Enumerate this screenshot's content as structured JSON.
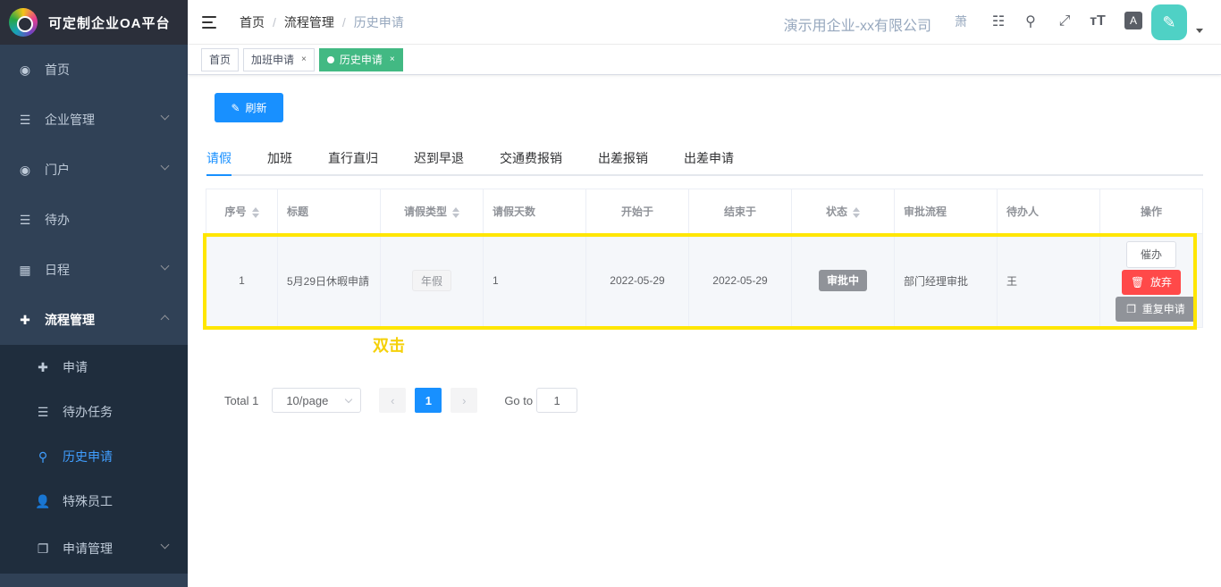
{
  "app": {
    "title": "可定制企业OA平台"
  },
  "sidebar": {
    "items": [
      {
        "label": "首页",
        "icon": "dashboard-icon"
      },
      {
        "label": "企业管理",
        "icon": "list-icon"
      },
      {
        "label": "门户",
        "icon": "dashboard-icon"
      },
      {
        "label": "待办",
        "icon": "list-icon"
      },
      {
        "label": "日程",
        "icon": "grid-icon"
      },
      {
        "label": "流程管理",
        "icon": "flow-icon"
      }
    ],
    "sub_items": [
      {
        "label": "申请",
        "icon": "flow-icon"
      },
      {
        "label": "待办任务",
        "icon": "list-icon"
      },
      {
        "label": "历史申请",
        "icon": "search-icon"
      },
      {
        "label": "特殊员工",
        "icon": "user-icon"
      },
      {
        "label": "申请管理",
        "icon": "copy-icon"
      }
    ]
  },
  "navbar": {
    "breadcrumb": [
      "首页",
      "流程管理",
      "历史申请"
    ],
    "company": "演示用企业-xx有限公司",
    "user_short": "萧"
  },
  "tags": [
    {
      "label": "首页"
    },
    {
      "label": "加班申请",
      "close": "×"
    },
    {
      "label": "历史申请",
      "close": "×"
    }
  ],
  "toolbar": {
    "refresh_label": "刷新"
  },
  "tabs": [
    "请假",
    "加班",
    "直行直归",
    "迟到早退",
    "交通费报销",
    "出差报销",
    "出差申请"
  ],
  "table": {
    "headers": [
      "序号",
      "标题",
      "请假类型",
      "请假天数",
      "开始于",
      "结束于",
      "状态",
      "审批流程",
      "待办人",
      "操作"
    ],
    "rows": [
      {
        "index": "1",
        "title": "5月29日休暇申請",
        "type": "年假",
        "days": "1",
        "start": "2022-05-29",
        "end": "2022-05-29",
        "status": "审批中",
        "process": "部门经理审批",
        "assignee": "王"
      }
    ],
    "actions": {
      "urge": "催办",
      "abandon": "放弃",
      "repeat": "重复申请"
    }
  },
  "annotation": {
    "text": "双击"
  },
  "pagination": {
    "total": "Total 1",
    "page_size": "10/page",
    "current": "1",
    "goto_label": "Go to",
    "goto_value": "1"
  }
}
